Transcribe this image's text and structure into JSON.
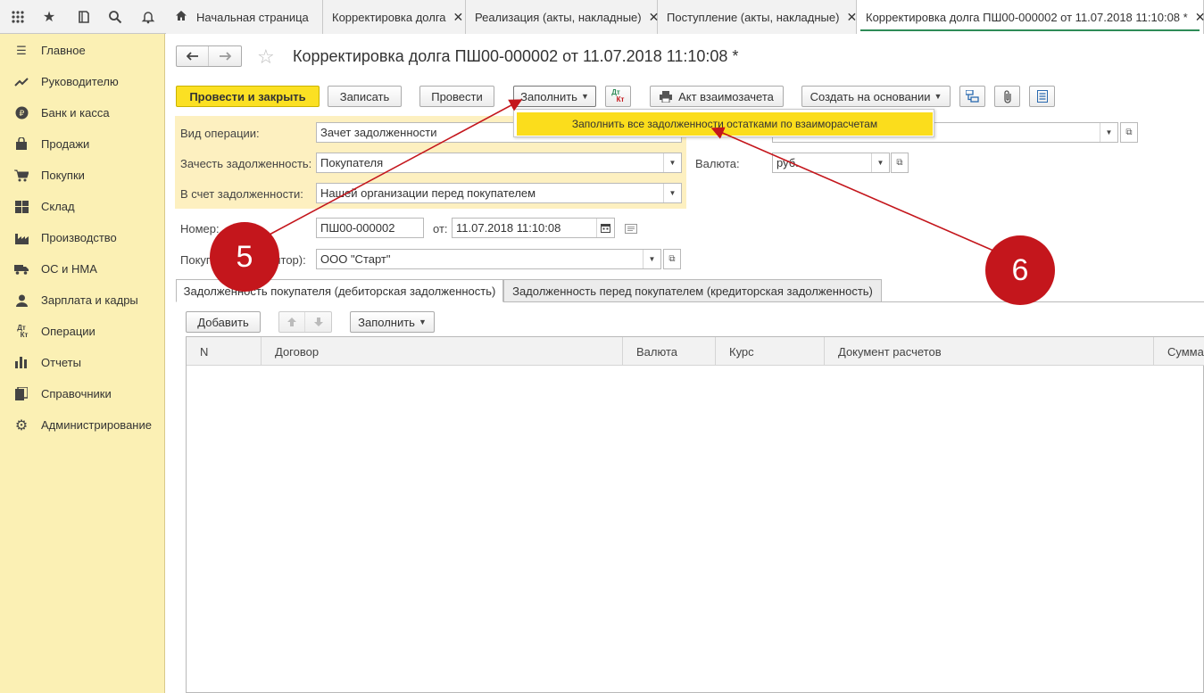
{
  "topbar": {
    "tabs": [
      {
        "label": "Начальная страница",
        "closable": false
      },
      {
        "label": "Корректировка долга",
        "closable": true
      },
      {
        "label": "Реализация (акты, накладные)",
        "closable": true
      },
      {
        "label": "Поступление (акты, накладные)",
        "closable": true
      },
      {
        "label": "Корректировка долга ПШ00-000002 от 11.07.2018 11:10:08 *",
        "closable": true,
        "active": true
      }
    ],
    "close_glyph": "✕"
  },
  "sidebar": {
    "items": [
      {
        "label": "Главное",
        "icon": "menu-lines-icon"
      },
      {
        "label": "Руководителю",
        "icon": "trend-icon"
      },
      {
        "label": "Банк и касса",
        "icon": "ruble-coin-icon"
      },
      {
        "label": "Продажи",
        "icon": "bag-icon"
      },
      {
        "label": "Покупки",
        "icon": "cart-icon"
      },
      {
        "label": "Склад",
        "icon": "warehouse-icon"
      },
      {
        "label": "Производство",
        "icon": "factory-icon"
      },
      {
        "label": "ОС и НМА",
        "icon": "truck-icon"
      },
      {
        "label": "Зарплата и кадры",
        "icon": "person-icon"
      },
      {
        "label": "Операции",
        "icon": "dt-kt-icon"
      },
      {
        "label": "Отчеты",
        "icon": "bar-chart-icon"
      },
      {
        "label": "Справочники",
        "icon": "books-icon"
      },
      {
        "label": "Администрирование",
        "icon": "gear-icon"
      }
    ]
  },
  "doc": {
    "title": "Корректировка долга ПШ00-000002 от 11.07.2018 11:10:08 *",
    "toolbar": {
      "post_close": "Провести и закрыть",
      "save": "Записать",
      "post": "Провести",
      "fill": "Заполнить",
      "dtkt_top": "Дт",
      "dtkt_bottom": "Кт",
      "act": "Акт взаимозачета",
      "create_based": "Создать на основании"
    },
    "fill_menu": {
      "item": "Заполнить все задолженности остатками по взаиморасчетам"
    },
    "fields": {
      "operation_label": "Вид операции:",
      "operation_value": "Зачет задолженности",
      "offset_label": "Зачесть задолженность:",
      "offset_value": "Покупателя",
      "against_label": "В счет задолженности:",
      "against_value": "Нашей организации перед покупателем",
      "currency_label": "Валюта:",
      "currency_value": "руб.",
      "number_label": "Номер:",
      "number_value": "ПШ00-000002",
      "date_label": "от:",
      "date_value": "11.07.2018 11:10:08",
      "buyer_label": "Покупатель (кредитор):",
      "buyer_value": "ООО \"Старт\""
    },
    "tabs": [
      {
        "label": "Задолженность покупателя (дебиторская задолженность)",
        "active": true
      },
      {
        "label": "Задолженность перед покупателем (кредиторская задолженность)",
        "active": false
      }
    ],
    "table_toolbar": {
      "add": "Добавить",
      "fill": "Заполнить"
    },
    "table": {
      "columns": [
        "N",
        "Договор",
        "Валюта",
        "Курс",
        "Документ расчетов",
        "Сумма"
      ]
    }
  },
  "annotations": {
    "marker5": "5",
    "marker6": "6",
    "color": "#c4161c"
  }
}
